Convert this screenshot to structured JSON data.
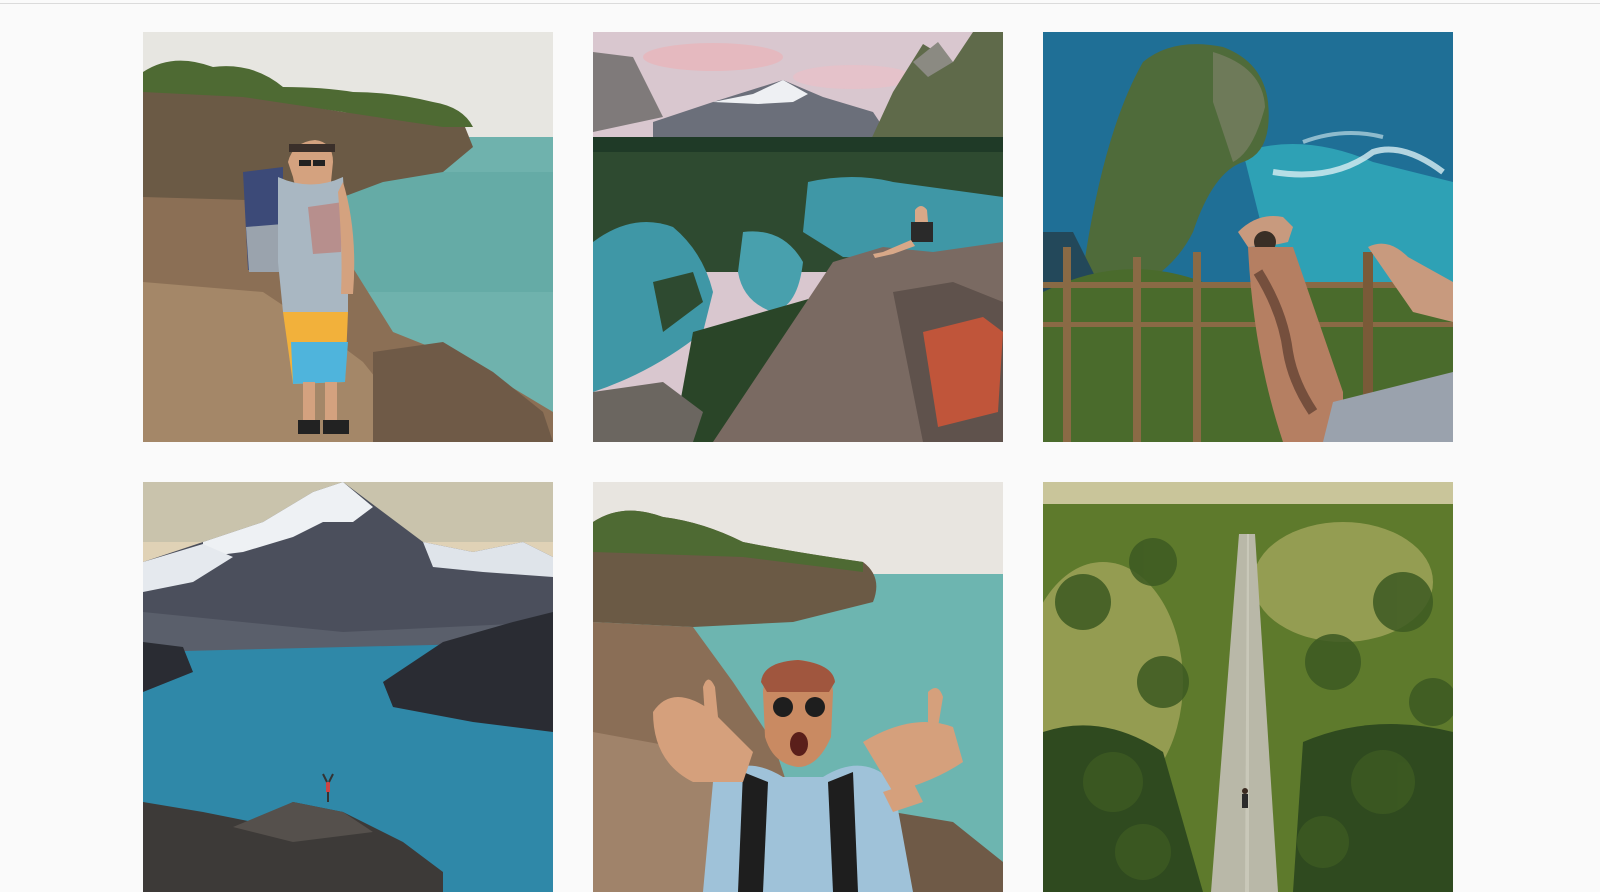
{
  "feed": {
    "posts": [
      {
        "subject": "hiker-on-coastal-cliff",
        "colors": {
          "sky": "#e7e6e1",
          "sea": "#6fb2ad",
          "rock": "#8b6f55",
          "shirt": "#a9b7c2",
          "shorts": "#f2b13b",
          "pack": "#3c4a78"
        }
      },
      {
        "subject": "hiker-above-alpine-lakes",
        "colors": {
          "sky": "#d9c7cf",
          "lake": "#3f97a6",
          "forest": "#2e4a30",
          "rock": "#7a6a62",
          "accent": "#c0553a"
        }
      },
      {
        "subject": "tattooed-arm-over-sea-cliff",
        "colors": {
          "sea": "#1f6f96",
          "cliff": "#4f6b3a",
          "foam": "#d8eef2",
          "rail": "#8a6a45",
          "skin": "#c89a7e"
        }
      },
      {
        "subject": "hiker-before-glacier-lake",
        "colors": {
          "sky": "#e0d2b6",
          "snow": "#eef1f4",
          "mountain": "#4b4f5c",
          "lake": "#2f88a8",
          "rock": "#3d3a38"
        }
      },
      {
        "subject": "excited-man-on-coast",
        "colors": {
          "sky": "#e8e5e0",
          "sea": "#6db5b0",
          "rock": "#8a6e56",
          "shirt": "#9fc2d9",
          "cap": "#a0563e"
        }
      },
      {
        "subject": "runner-on-jungle-road",
        "colors": {
          "canopy": "#5e7a2c",
          "light": "#d8c780",
          "shade": "#2f4a1f",
          "road": "#b9b8a8"
        }
      }
    ]
  }
}
